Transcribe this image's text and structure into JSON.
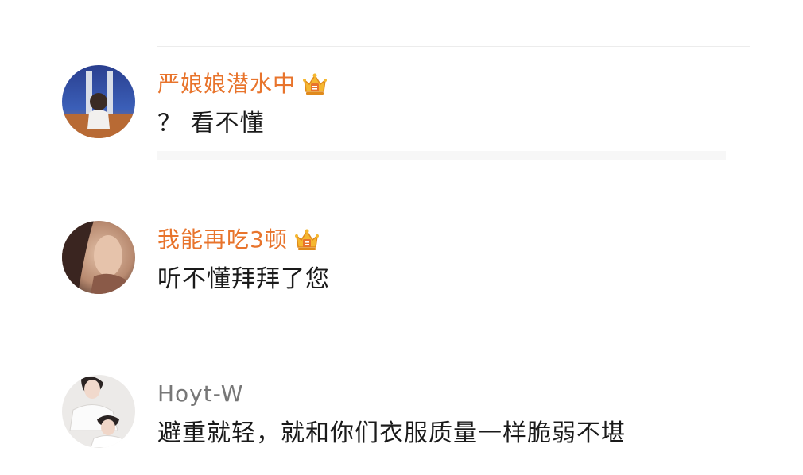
{
  "colors": {
    "vip_username": "#e8742c",
    "plain_username": "#777777",
    "comment_text": "#1a1a1a",
    "divider": "#ececec"
  },
  "comments": [
    {
      "username": "严娘娘潜水中",
      "vip": true,
      "vip_icon": "crown-badge-icon",
      "text": "？ 看不懂"
    },
    {
      "username": "我能再吃3顿",
      "vip": true,
      "vip_icon": "crown-badge-icon",
      "text": "听不懂拜拜了您"
    },
    {
      "username": "Hoyt-W",
      "vip": false,
      "text": "避重就轻，就和你们衣服质量一样脆弱不堪"
    }
  ]
}
